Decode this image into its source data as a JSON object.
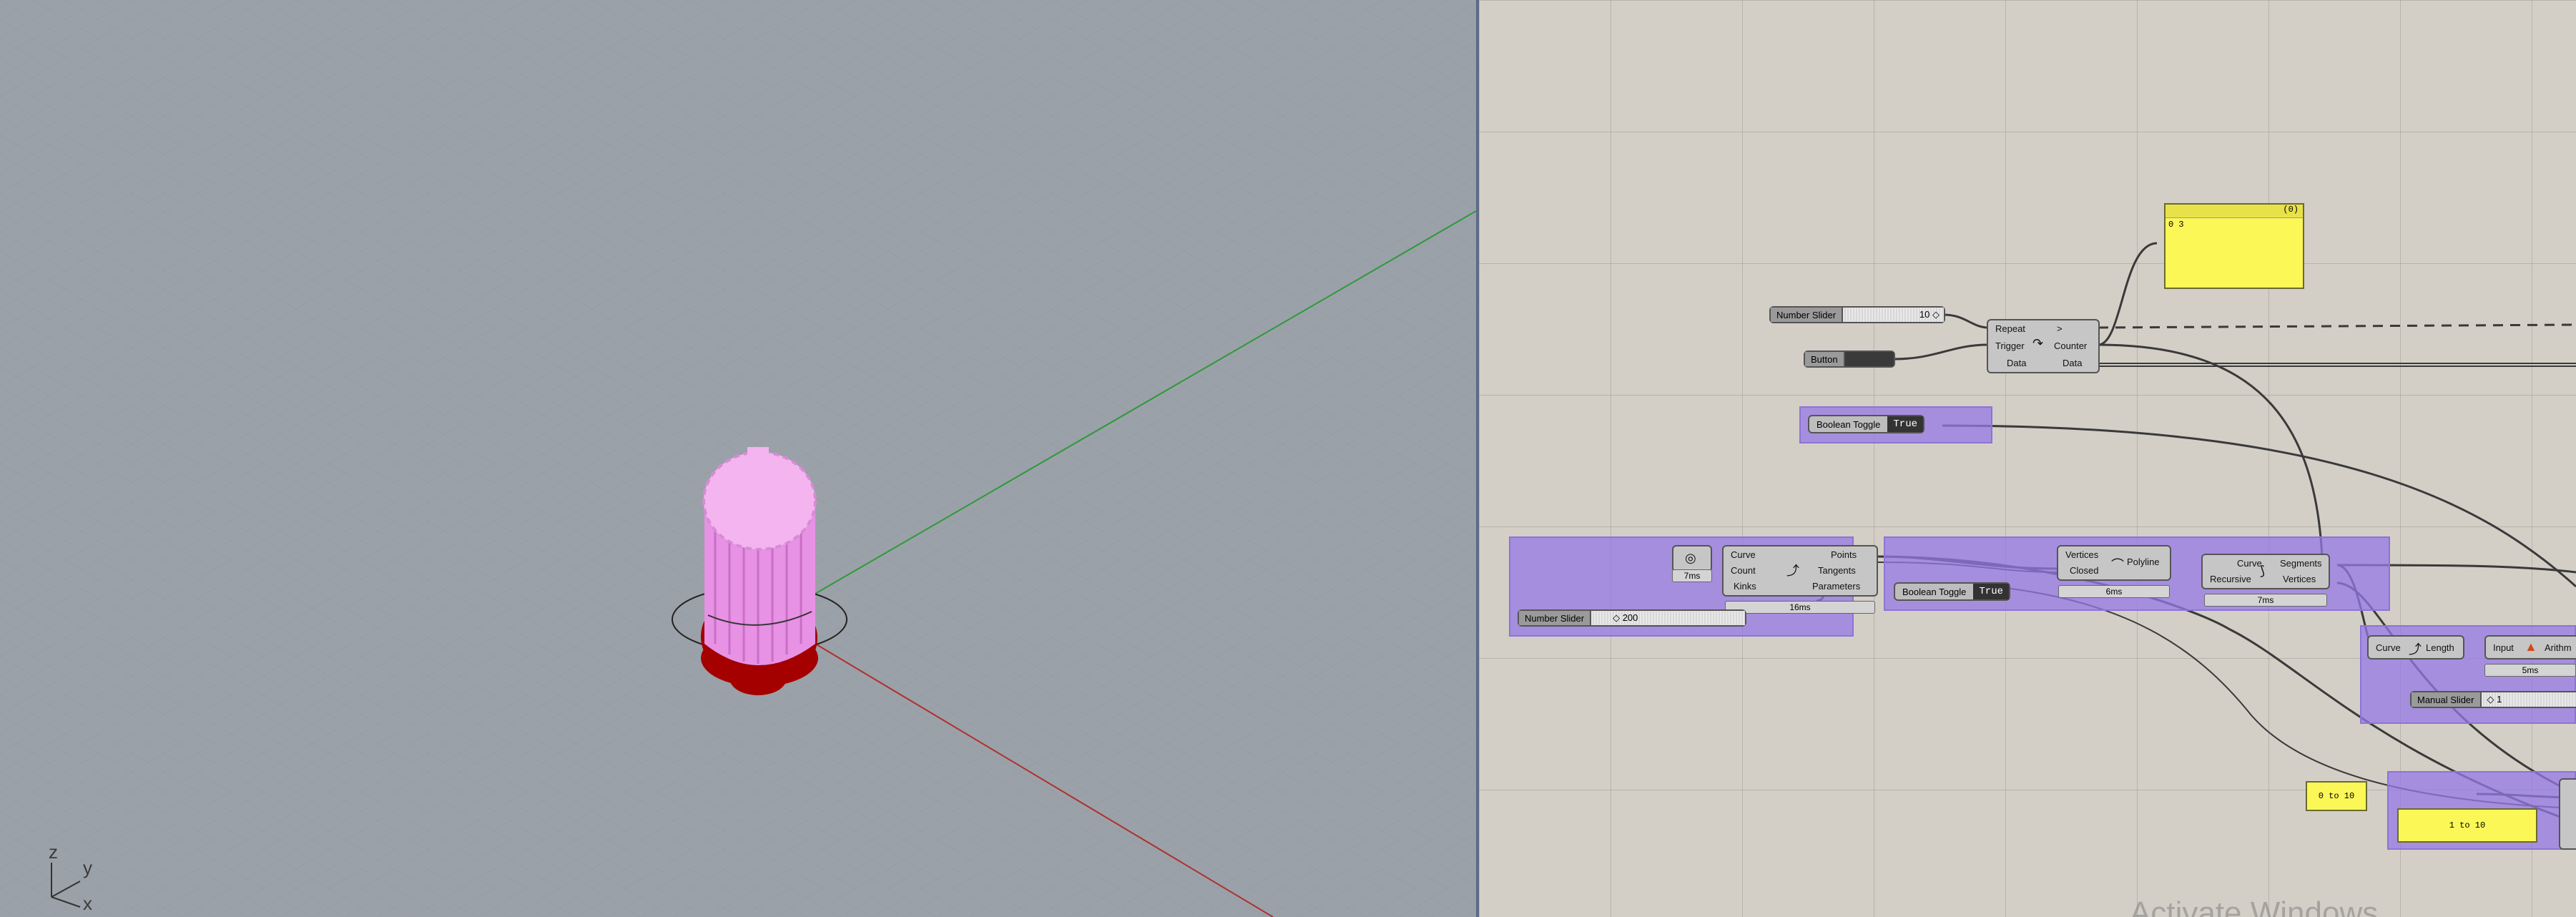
{
  "viewport": {
    "axis_labels": {
      "z": "z",
      "y": "y",
      "x": "x"
    }
  },
  "canvas": {
    "number_slider_top": {
      "label": "Number Slider",
      "value": "10 ◇"
    },
    "button": {
      "label": "Button"
    },
    "loop_component": {
      "inputs": [
        "Repeat",
        "Trigger",
        "Data"
      ],
      "outputs": [
        ">",
        "Counter",
        "Data"
      ]
    },
    "panel_top": {
      "header": "(0)",
      "row": "0 3"
    },
    "boolean_toggle_top": {
      "label": "Boolean Toggle",
      "value": "True"
    },
    "divide_component": {
      "inputs": [
        "Curve",
        "Count",
        "Kinks"
      ],
      "outputs": [
        "Points",
        "Tangents",
        "Parameters"
      ],
      "timer": "16ms"
    },
    "circle_timer": "7ms",
    "number_slider_bottom": {
      "label": "Number Slider",
      "value": "◇ 200"
    },
    "polyline_component": {
      "inputs": [
        "Vertices",
        "Closed"
      ],
      "output": "Polyline",
      "timer": "6ms"
    },
    "boolean_toggle_bottom": {
      "label": "Boolean Toggle",
      "value": "True"
    },
    "explode_component": {
      "inputs": [
        "Curve",
        "Recursive"
      ],
      "outputs": [
        "Segments",
        "Vertices"
      ],
      "timer": "7ms"
    },
    "length_component": {
      "input": "Curve",
      "output": "Length"
    },
    "arith_component": {
      "input": "Input",
      "output": "Arithm"
    },
    "arith_timer": "5ms",
    "manual_slider": {
      "label": "Manual Slider",
      "value": "◇ 1"
    },
    "range_panel_a": "0 to 10",
    "range_panel_b": "1 to 10",
    "watermark": "Activate Windows"
  },
  "colors": {
    "viewport_bg": "#9ba1a8",
    "canvas_bg": "#d3cfc7",
    "group_fill": "#9678e6",
    "panel_yellow": "#fbf757",
    "model_pink": "#f0a8ee",
    "model_red": "#b00000"
  }
}
